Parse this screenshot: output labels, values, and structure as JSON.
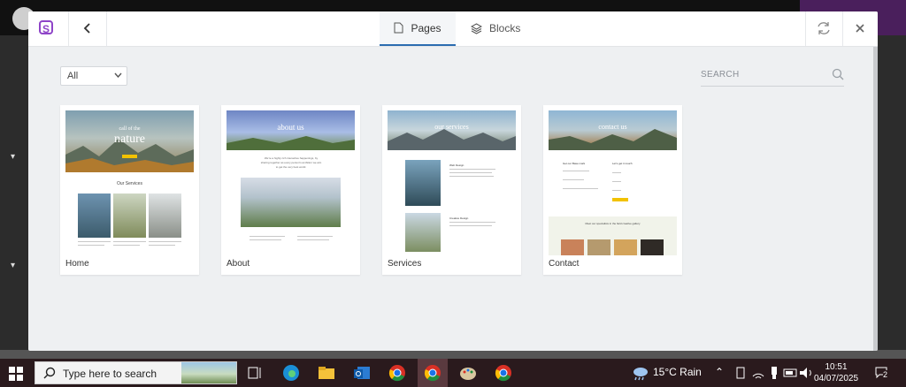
{
  "modal": {
    "tabs": [
      {
        "label": "Pages",
        "active": true
      },
      {
        "label": "Blocks",
        "active": false
      }
    ],
    "filter": {
      "selected": "All"
    },
    "search": {
      "placeholder": "SEARCH"
    },
    "brand_letter": "S"
  },
  "templates": [
    {
      "label": "Home",
      "hero_small": "call of the",
      "hero_title": "nature",
      "section": "Our Services"
    },
    {
      "label": "About",
      "hero_title": "about us",
      "intro": "We're a highly rich interactive happenings, by sharing together as every person's ambition we aim to get the very best world."
    },
    {
      "label": "Services",
      "hero_title": "our services",
      "item1": "Web Design",
      "item2": "Creative Design"
    },
    {
      "label": "Contact",
      "hero_title": "contact us",
      "col1": "Get our Base mark",
      "col2": "Let's get in touch",
      "cta": "Meet our specialists in the field creative gallery"
    }
  ],
  "taskbar": {
    "search_placeholder": "Type here to search",
    "weather": "15°C Rain",
    "time": "10:51",
    "date": "04/07/2025",
    "notifications": "2"
  },
  "colors": {
    "accent": "#2b6cb0",
    "brand": "#8e44c8",
    "taskbar": "#2a1a1d"
  }
}
